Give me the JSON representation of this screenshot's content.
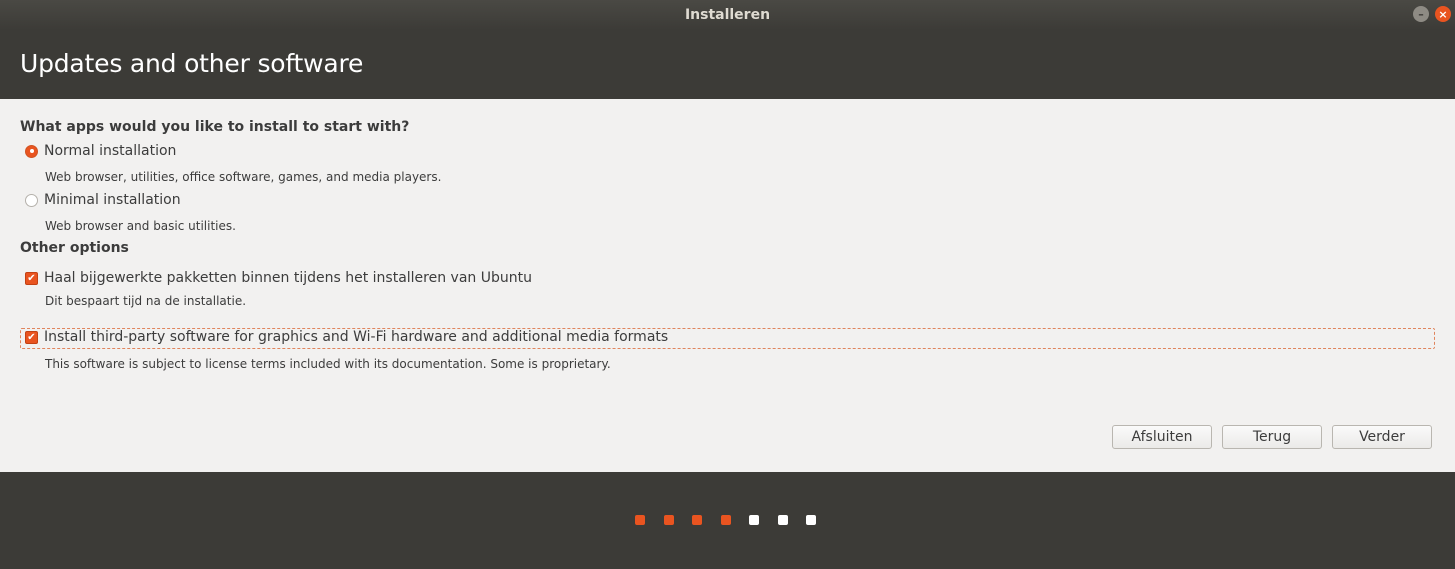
{
  "window": {
    "title": "Installeren",
    "minimize_glyph": "–",
    "close_glyph": "×"
  },
  "header": {
    "title": "Updates and other software"
  },
  "install_type": {
    "heading": "What apps would you like to install to start with?",
    "options": [
      {
        "label": "Normal installation",
        "description": "Web browser, utilities, office software, games, and media players.",
        "selected": true
      },
      {
        "label": "Minimal installation",
        "description": "Web browser and basic utilities.",
        "selected": false
      }
    ]
  },
  "other_options": {
    "heading": "Other options",
    "items": [
      {
        "label": "Haal bijgewerkte pakketten binnen tijdens het installeren van Ubuntu",
        "description": "Dit bespaart tijd na de installatie.",
        "checked": true,
        "check_glyph": "✔"
      },
      {
        "label": "Install third-party software for graphics and Wi-Fi hardware and additional media formats",
        "description": "This software is subject to license terms included with its documentation. Some is proprietary.",
        "checked": true,
        "check_glyph": "✔"
      }
    ]
  },
  "buttons": {
    "quit": "Afsluiten",
    "back": "Terug",
    "next": "Verder"
  },
  "progress": {
    "total_steps": 7,
    "completed_steps": 4
  },
  "colors": {
    "accent": "#e95420",
    "header_bg": "#3c3b37",
    "body_bg": "#f2f1f0"
  }
}
